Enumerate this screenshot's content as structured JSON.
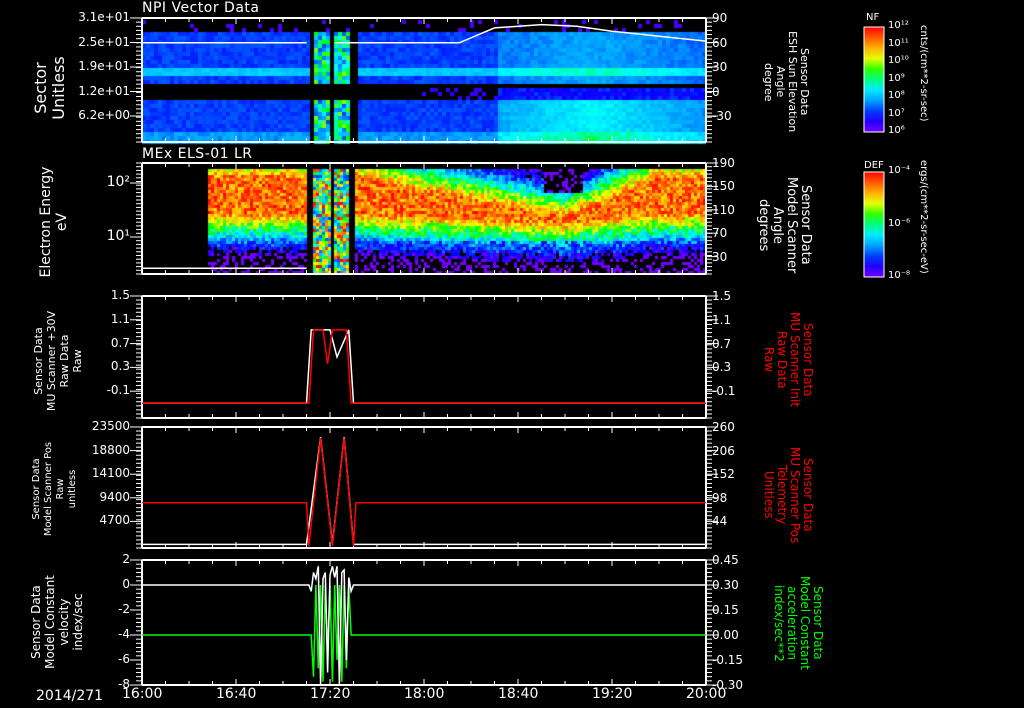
{
  "date_label": "2014/271",
  "time_axis": {
    "ticks": [
      "16:00",
      "16:40",
      "17:20",
      "18:00",
      "18:40",
      "19:20",
      "20:00"
    ],
    "range_minutes_from_1600": [
      0,
      240
    ]
  },
  "colors": {
    "red": "#ff0000",
    "green": "#00ff00",
    "white": "#ffffff"
  },
  "colorbars": [
    {
      "title": "NF",
      "unit": "cnts/(cm**2-sr-sec)",
      "ticks": [
        "10¹²",
        "10¹¹",
        "10¹⁰",
        "10⁹",
        "10⁸",
        "10⁷",
        "10⁶"
      ]
    },
    {
      "title": "DEF",
      "unit": "ergs/(cm**2-sr-sec-eV)",
      "ticks": [
        "10⁻⁴",
        "10⁻⁶",
        "10⁻⁸"
      ]
    }
  ],
  "chart_data": [
    {
      "type": "heatmap",
      "title": "NPI Vector Data",
      "ylabel": [
        "Sector",
        "Unitless"
      ],
      "yticks": [
        "3.1e+01",
        "2.5e+01",
        "1.9e+01",
        "1.2e+01",
        "6.2e+00"
      ],
      "ylim": [
        0,
        31
      ],
      "y2label": [
        "Sensor Data",
        "ESH Sun Elevation",
        "Angle",
        "degree"
      ],
      "y2ticks": [
        "90",
        "60",
        "30",
        "0",
        "-30"
      ],
      "y2lim": [
        -60,
        90
      ],
      "overlay_line": {
        "name": "ESH Sun Elevation",
        "color": "#ffffff",
        "x_min": [
          0,
          70,
          71,
          81,
          82,
          135,
          150,
          170,
          185,
          200,
          220,
          240
        ],
        "y": [
          60,
          60,
          null,
          null,
          60,
          60,
          78,
          82,
          80,
          74,
          68,
          62
        ]
      }
    },
    {
      "type": "heatmap",
      "title": "MEx ELS-01 LR",
      "ylabel": [
        "Electron Energy",
        "eV"
      ],
      "yticks": [
        "10²",
        "10¹"
      ],
      "ylim_log": [
        1.5,
        200
      ],
      "y2label": [
        "Sensor Data",
        "Model Scanner",
        "Angle",
        "degrees"
      ],
      "y2ticks": [
        "190",
        "150",
        "110",
        "70",
        "30"
      ],
      "y2lim": [
        0,
        190
      ],
      "overlay_line": {
        "name": "Model Scanner Angle",
        "color": "#ffffff",
        "x_min": [
          0,
          70
        ],
        "y": [
          10,
          10
        ]
      }
    },
    {
      "type": "line",
      "ylabel": [
        "Sensor Data",
        "MU Scanner +30V",
        "Raw Data",
        "Raw"
      ],
      "yticks": [
        "1.5",
        "1.1",
        "0.7",
        "0.3",
        "-0.1"
      ],
      "ylim": [
        -0.3,
        1.5
      ],
      "y2label": [
        "Sensor Data",
        "MU Scanner Init",
        "Raw Data",
        "Raw"
      ],
      "y2ticks": [
        "1.5",
        "1.1",
        "0.7",
        "0.3",
        "-0.1"
      ],
      "y2lim": [
        -0.3,
        1.5
      ],
      "series": [
        {
          "name": "MU Scanner +30V",
          "color": "#ffffff",
          "x_min": [
            0,
            70,
            72,
            80,
            83,
            88,
            90,
            240
          ],
          "y": [
            -0.08,
            -0.08,
            1.0,
            1.0,
            0.6,
            1.0,
            -0.08,
            -0.08
          ]
        },
        {
          "name": "MU Scanner Init",
          "color": "#ff0000",
          "x_min": [
            0,
            71,
            73,
            77,
            79,
            81,
            84,
            87,
            89,
            240
          ],
          "y": [
            -0.08,
            -0.08,
            1.0,
            1.0,
            0.5,
            1.0,
            1.0,
            1.0,
            -0.08,
            -0.08
          ]
        }
      ]
    },
    {
      "type": "line",
      "ylabel": [
        "Sensor Data",
        "Model Scanner Pos",
        "Raw",
        "unitless"
      ],
      "yticks": [
        "23500",
        "18800",
        "14100",
        "9400",
        "4700"
      ],
      "ylim": [
        0,
        23500
      ],
      "y2label": [
        "Sensor Data",
        "MU Scanner Pos",
        "Telemetry",
        "Unitless"
      ],
      "y2ticks": [
        "260",
        "206",
        "152",
        "98",
        "44"
      ],
      "y2lim": [
        -10,
        260
      ],
      "series": [
        {
          "name": "Model Scanner Pos",
          "color": "#ffffff",
          "x_min": [
            0,
            70,
            76,
            81,
            86,
            90,
            240
          ],
          "y": [
            700,
            700,
            21500,
            700,
            21500,
            700,
            700
          ]
        },
        {
          "name": "MU Scanner Pos",
          "color": "#ff0000",
          "x_min": [
            0,
            70,
            71,
            76,
            81,
            86,
            90,
            91,
            240
          ],
          "y": [
            91,
            91,
            -5,
            235,
            -5,
            235,
            -5,
            91,
            91
          ]
        }
      ]
    },
    {
      "type": "line",
      "ylabel": [
        "Sensor Data",
        "Model Constant",
        "velocity",
        "index/sec"
      ],
      "yticks": [
        "2",
        "0",
        "-2",
        "-4",
        "-6",
        "-8"
      ],
      "ylim": [
        -8,
        2
      ],
      "y2label": [
        "Sensor Data",
        "Model Constant",
        "acceleration",
        "index/sec**2"
      ],
      "y2ticks": [
        "0.45",
        "0.30",
        "0.15",
        "0.00",
        "-0.15",
        "-0.30"
      ],
      "y2lim": [
        -0.3,
        0.45
      ],
      "series": [
        {
          "name": "Model Constant velocity",
          "color": "#ffffff",
          "x_min": [
            0,
            71,
            72,
            73,
            74,
            75,
            76,
            77,
            78,
            79,
            80,
            81,
            82,
            83,
            84,
            85,
            86,
            87,
            88,
            89,
            90,
            240
          ],
          "y": [
            0,
            0,
            -0.5,
            1.0,
            0.5,
            1.5,
            -8,
            0.5,
            1.0,
            -7,
            0.8,
            1.5,
            0.6,
            1.5,
            -8,
            1.0,
            1.2,
            -6,
            0.6,
            -0.5,
            0,
            0
          ]
        },
        {
          "name": "Model Constant acceleration",
          "color": "#00ff00",
          "x_min": [
            0,
            72,
            73,
            74,
            75,
            76,
            77,
            78,
            79,
            80,
            81,
            82,
            83,
            84,
            85,
            86,
            87,
            88,
            89,
            240
          ],
          "y": [
            0,
            0,
            -0.25,
            0.3,
            -0.2,
            0.3,
            -0.28,
            0.3,
            -0.1,
            0.3,
            -0.28,
            0.3,
            -0.15,
            0.3,
            -0.28,
            0.3,
            -0.2,
            0.3,
            0,
            0
          ]
        }
      ]
    }
  ]
}
